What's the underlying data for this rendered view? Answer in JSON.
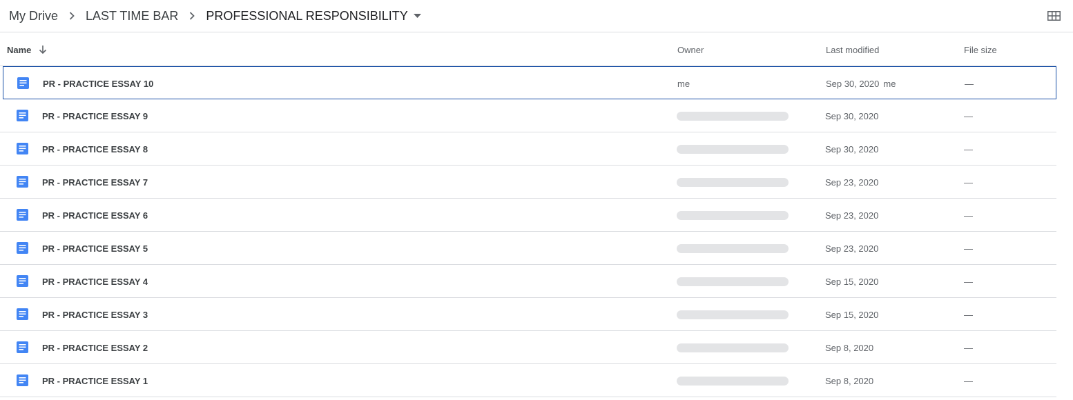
{
  "breadcrumb": {
    "items": [
      {
        "label": "My Drive"
      },
      {
        "label": "LAST TIME BAR"
      },
      {
        "label": "PROFESSIONAL RESPONSIBILITY"
      }
    ]
  },
  "view_toggle": {
    "icon": "grid-view-icon"
  },
  "columns": {
    "name": "Name",
    "owner": "Owner",
    "last_modified": "Last modified",
    "file_size": "File size"
  },
  "sort": {
    "column": "name",
    "icon": "arrow-down-icon"
  },
  "colors": {
    "doc_icon": "#4285f4",
    "selection_border": "#174ea6",
    "owner_placeholder": "#e3e4e6"
  },
  "files": [
    {
      "name": "PR - PRACTICE ESSAY 10",
      "owner": "me",
      "modified": "Sep 30, 2020",
      "modified_by": "me",
      "size": "—",
      "selected": true
    },
    {
      "name": "PR - PRACTICE ESSAY 9",
      "owner": "",
      "modified": "Sep 30, 2020",
      "modified_by": "",
      "size": "—"
    },
    {
      "name": "PR - PRACTICE ESSAY 8",
      "owner": "",
      "modified": "Sep 30, 2020",
      "modified_by": "",
      "size": "—"
    },
    {
      "name": "PR - PRACTICE ESSAY 7",
      "owner": "",
      "modified": "Sep 23, 2020",
      "modified_by": "",
      "size": "—"
    },
    {
      "name": "PR - PRACTICE ESSAY 6",
      "owner": "",
      "modified": "Sep 23, 2020",
      "modified_by": "",
      "size": "—"
    },
    {
      "name": "PR - PRACTICE ESSAY 5",
      "owner": "",
      "modified": "Sep 23, 2020",
      "modified_by": "",
      "size": "—"
    },
    {
      "name": "PR - PRACTICE ESSAY 4",
      "owner": "",
      "modified": "Sep 15, 2020",
      "modified_by": "",
      "size": "—"
    },
    {
      "name": "PR - PRACTICE ESSAY 3",
      "owner": "",
      "modified": "Sep 15, 2020",
      "modified_by": "",
      "size": "—"
    },
    {
      "name": "PR - PRACTICE ESSAY 2",
      "owner": "",
      "modified": "Sep 8, 2020",
      "modified_by": "",
      "size": "—"
    },
    {
      "name": "PR - PRACTICE ESSAY 1",
      "owner": "",
      "modified": "Sep 8, 2020",
      "modified_by": "",
      "size": "—"
    }
  ]
}
